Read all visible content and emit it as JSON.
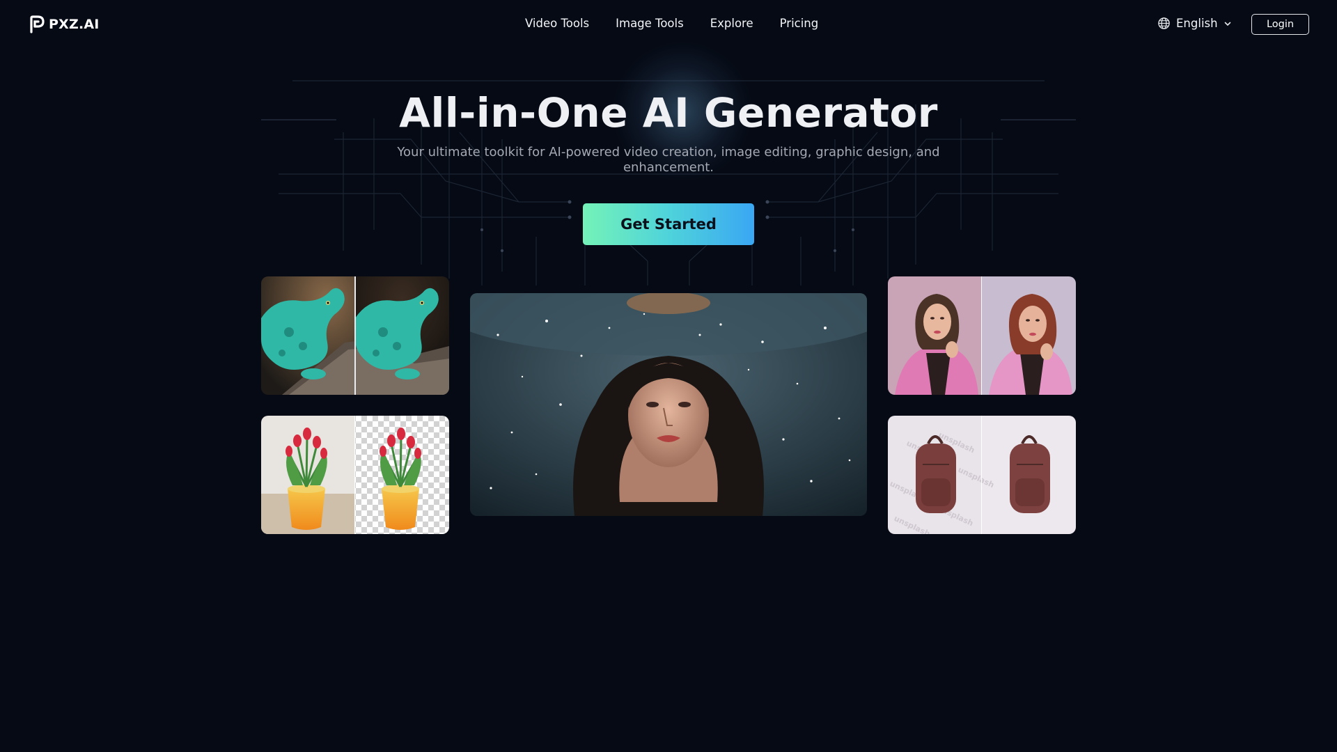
{
  "header": {
    "logo_text": "PXZ.AI",
    "nav": [
      "Video Tools",
      "Image Tools",
      "Explore",
      "Pricing"
    ],
    "language": "English",
    "login_label": "Login"
  },
  "hero": {
    "title": "All-in-One AI Generator",
    "subtitle": "Your ultimate toolkit for AI-powered video creation, image editing, graphic design, and enhancement.",
    "cta_label": "Get Started"
  },
  "showcase": {
    "cards": [
      {
        "name": "lizard-enhance",
        "subject": "lizard"
      },
      {
        "name": "flower-background-removal",
        "subject": "tulips"
      },
      {
        "name": "underwater-portrait",
        "subject": "portrait"
      },
      {
        "name": "portrait-restyle",
        "subject": "portrait"
      },
      {
        "name": "backpack-watermark-removal",
        "subject": "backpack"
      }
    ],
    "watermark_text": "unsplash"
  },
  "colors": {
    "background": "#050a14",
    "cta_gradient_start": "#74f2b8",
    "cta_gradient_end": "#3aa7f3"
  },
  "icons": [
    "logo-icon",
    "globe-icon",
    "chevron-down-icon"
  ]
}
